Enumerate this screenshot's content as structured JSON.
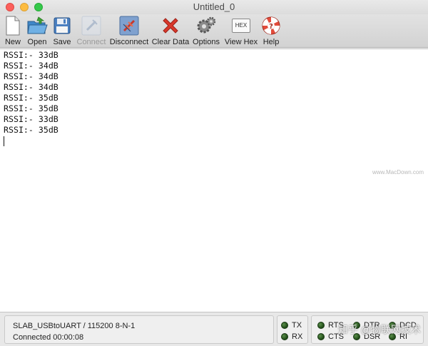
{
  "window": {
    "title": "Untitled_0"
  },
  "toolbar": {
    "items": [
      {
        "label": "New",
        "icon": "document-new-icon",
        "enabled": true
      },
      {
        "label": "Open",
        "icon": "folder-open-icon",
        "enabled": true
      },
      {
        "label": "Save",
        "icon": "floppy-disk-icon",
        "enabled": true
      },
      {
        "label": "Connect",
        "icon": "plug-connect-icon",
        "enabled": false
      },
      {
        "label": "Disconnect",
        "icon": "plug-disconnect-icon",
        "enabled": true
      },
      {
        "label": "Clear Data",
        "icon": "red-x-icon",
        "enabled": true
      },
      {
        "label": "Options",
        "icon": "gears-icon",
        "enabled": true
      },
      {
        "label": "View Hex",
        "icon": "hex-icon",
        "enabled": true
      },
      {
        "label": "Help",
        "icon": "lifebuoy-icon",
        "enabled": true
      }
    ],
    "hex_icon_text": "HEX"
  },
  "terminal": {
    "lines": [
      "RSSI:- 33dB",
      "RSSI:- 34dB",
      "RSSI:- 34dB",
      "RSSI:- 34dB",
      "RSSI:- 35dB",
      "RSSI:- 35dB",
      "RSSI:- 33dB",
      "RSSI:- 35dB"
    ],
    "watermark": "www.MacDown.com"
  },
  "status": {
    "port_settings": "SLAB_USBtoUART / 115200 8-N-1",
    "connection": "Connected 00:00:08",
    "tx_label": "TX",
    "rx_label": "RX",
    "rts_label": "RTS",
    "dtr_label": "DTR",
    "dcd_label": "DCD",
    "cts_label": "CTS",
    "dsr_label": "DSR",
    "ri_label": "RI",
    "overlay": "知乎 @物联网技术"
  }
}
